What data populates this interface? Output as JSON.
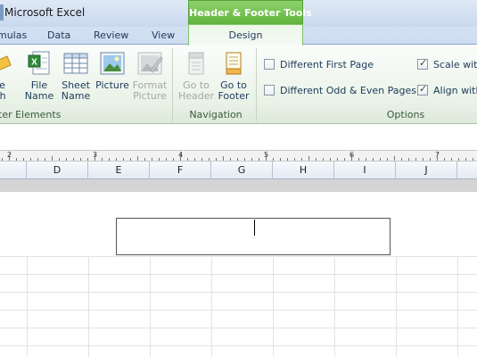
{
  "app": {
    "title": "Microsoft Excel"
  },
  "tabs": [
    {
      "label": "mulas"
    },
    {
      "label": "Data"
    },
    {
      "label": "Review"
    },
    {
      "label": "View"
    }
  ],
  "contextual_tab": {
    "group_title": "Header & Footer Tools",
    "tab_label": "Design",
    "accent": "#5fb43c"
  },
  "ribbon": {
    "elements_group": {
      "label": "ter Elements",
      "buttons": [
        {
          "line1": "le",
          "line2": "th",
          "icon": "sheet-name-icon",
          "enabled": true
        },
        {
          "line1": "File",
          "line2": "Name",
          "icon": "file-name-icon",
          "enabled": true
        },
        {
          "line1": "Sheet",
          "line2": "Name",
          "icon": "sheet-grid-icon",
          "enabled": true
        },
        {
          "line1": "Picture",
          "line2": "",
          "icon": "picture-icon",
          "enabled": true
        },
        {
          "line1": "Format",
          "line2": "Picture",
          "icon": "format-picture-icon",
          "enabled": false
        }
      ]
    },
    "navigation_group": {
      "label": "Navigation",
      "buttons": [
        {
          "line1": "Go to",
          "line2": "Header",
          "icon": "go-to-header-icon",
          "enabled": false
        },
        {
          "line1": "Go to",
          "line2": "Footer",
          "icon": "go-to-footer-icon",
          "enabled": true
        }
      ]
    },
    "options_group": {
      "label": "Options",
      "checkboxes": [
        {
          "label": "Different First Page",
          "checked": false
        },
        {
          "label": "Different Odd & Even Pages",
          "checked": false
        },
        {
          "label": "Scale with",
          "checked": true
        },
        {
          "label": "Align with",
          "checked": true
        }
      ]
    }
  },
  "ruler": {
    "numbers": [
      "2",
      "3",
      "4",
      "5",
      "6",
      "7"
    ]
  },
  "columns": [
    "D",
    "E",
    "F",
    "G",
    "H",
    "I",
    "J"
  ]
}
